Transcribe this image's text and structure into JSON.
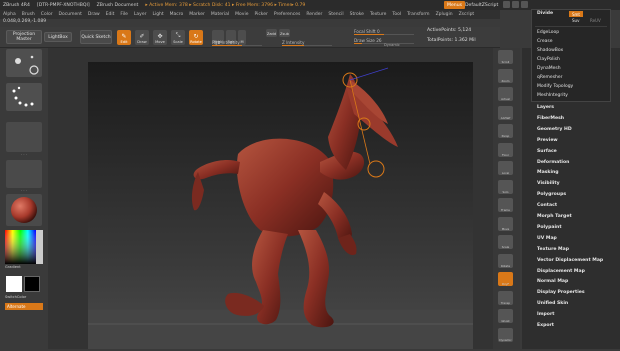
{
  "title_bar": {
    "app": "ZBrush 4R4",
    "document": "[DTR-PMPF-XNOTHBQI]",
    "doc_label": "ZBrush Document",
    "status": "▸ Active Mem: 378 ▸ Scratch Disk: 41 ▸ Free Mem: 3796 ▸ Timer▸ 0.79"
  },
  "menus": [
    "Alpha",
    "Brush",
    "Color",
    "Document",
    "Draw",
    "Edit",
    "File",
    "Layer",
    "Light",
    "Macro",
    "Marker",
    "Material",
    "Movie",
    "Picker",
    "Preferences",
    "Render",
    "Stencil",
    "Stroke",
    "Texture",
    "Tool",
    "Transform",
    "Zplugin",
    "Zscript"
  ],
  "menus_button": "Menus",
  "default_script": "DefaultZScript",
  "coords": "0.048,0.269,-1.089",
  "shelf": {
    "projection_master": "Projection Master",
    "lightbox": "LightBox",
    "quick_sketch": "Quick Sketch",
    "tools": [
      "Edit",
      "Draw",
      "Move",
      "Scale",
      "Rotate"
    ],
    "mrgb": "Mrgb",
    "rgb": "Rgb",
    "m": "M",
    "zadd": "Zadd",
    "zsub": "Zsub",
    "rgb_intensity": "Rgb Intensity",
    "z_intensity": "Z Intensity",
    "focal_shift_label": "Focal Shift",
    "focal_shift_value": "0",
    "draw_size_label": "Draw Size",
    "draw_size_value": "26",
    "dynamic": "Dynamic",
    "active_points": "ActivePoints: 5,124",
    "total_points": "TotalPoints: 1.362 Mil"
  },
  "left_panel": {
    "gradient": "Gradient",
    "switch_color": "SwitchColor",
    "alternate": "Alternate"
  },
  "dropdown": {
    "divide": "Divide",
    "smt": "Smt",
    "suv": "Suv",
    "reuv": "ReUV",
    "items": [
      "EdgeLoop",
      "Crease",
      "ShadowBox",
      "ClayPolish",
      "DynaMesh",
      "qRemesher",
      "Modify Topology",
      "MeshIntegrity"
    ]
  },
  "palette_items": [
    "Layers",
    "FiberMesh",
    "Geometry HD",
    "Preview",
    "Surface",
    "Deformation",
    "Masking",
    "Visibility",
    "Polygroups",
    "Contact",
    "Morph Target",
    "Polypaint",
    "UV Map",
    "Texture Map",
    "Vector Displacement Map",
    "Displacement Map",
    "Normal Map",
    "Display Properties",
    "Unified Skin",
    "Import",
    "Export"
  ],
  "right_shelf_labels": [
    "Scroll",
    "Zoom",
    "Actual",
    "AAHalf",
    "Persp",
    "Floor",
    "Local",
    "Solo",
    "Frame",
    "Move",
    "Scale",
    "Rotate",
    "PolyF",
    "Transp",
    "Ghost",
    "Dynamic"
  ],
  "colors": {
    "accent": "#d97818",
    "figure": "#8a2f24",
    "background": "#3a3a3a"
  }
}
